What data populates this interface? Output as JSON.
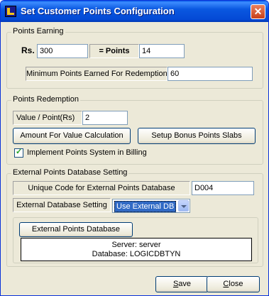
{
  "window": {
    "title": "Set Customer Points Configuration",
    "close_glyph": "✕"
  },
  "earning": {
    "legend": "Points Earning",
    "rs_label": "Rs.",
    "rs_value": "300",
    "points_label": "= Points",
    "points_value": "14",
    "min_label": "Minimum Points Earned For Redemption",
    "min_value": "60"
  },
  "redemption": {
    "legend": "Points Redemption",
    "value_label": "Value / Point(Rs)",
    "value_value": "2",
    "amount_button": "Amount For Value Calculation",
    "bonus_button": "Setup Bonus Points Slabs",
    "implement_label": "Implement Points System in Billing",
    "implement_checked": true
  },
  "external": {
    "legend": "External Points Database Setting",
    "code_label": "Unique Code for External Points Database",
    "code_value": "D004",
    "setting_label": "External Database Setting",
    "setting_value": "Use External DB",
    "db_button": "External Points Database",
    "server_line": "Server: server",
    "database_line": "Database: LOGICDBTYN"
  },
  "footer": {
    "save_label": "Save",
    "save_accel_char": "S",
    "save_rest": "ave",
    "close_label": "Close",
    "close_accel_char": "C",
    "close_rest": "lose"
  }
}
